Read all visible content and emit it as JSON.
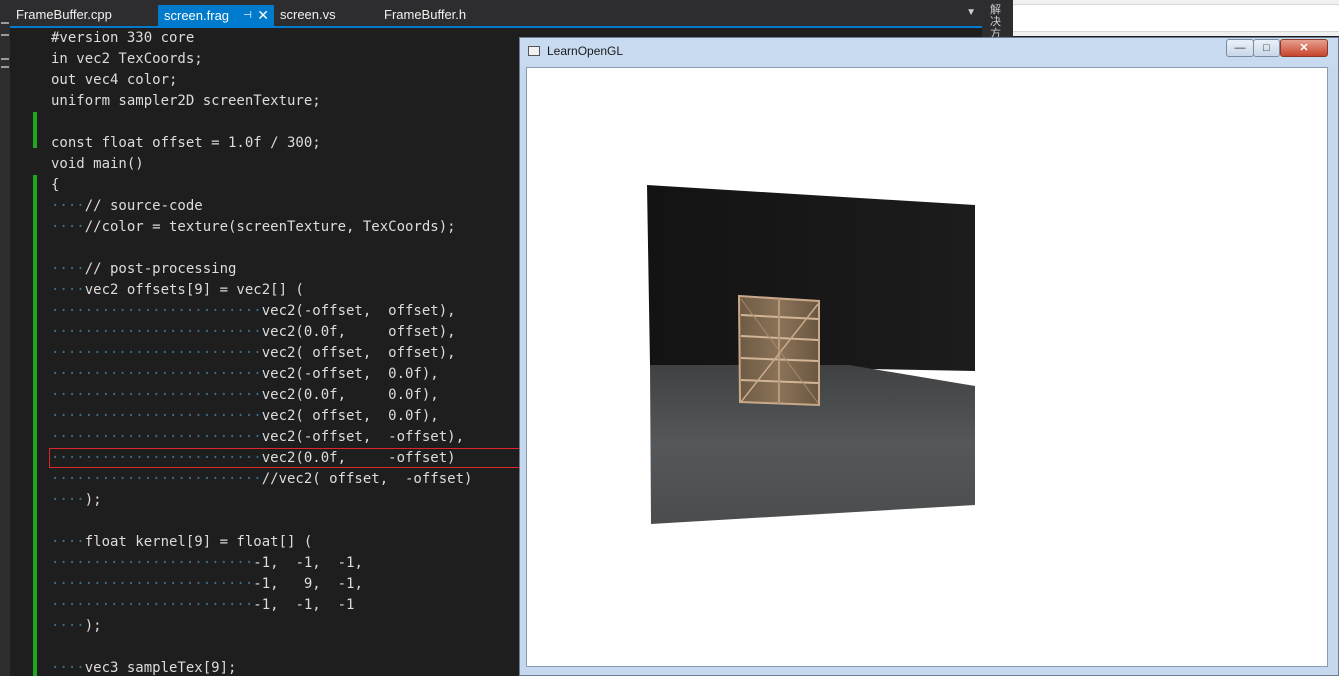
{
  "tabs": [
    {
      "label": "FrameBuffer.cpp",
      "active": false
    },
    {
      "label": "screen.frag",
      "active": true,
      "pin_icon": "pin-icon",
      "close_icon": "close-icon"
    },
    {
      "label": "screen.vs",
      "active": false
    },
    {
      "label": "FrameBuffer.h",
      "active": false
    }
  ],
  "side_panel_title": "解决方",
  "editor": {
    "lines": [
      "#version 330 core",
      "in vec2 TexCoords;",
      "out vec4 color;",
      "uniform sampler2D screenTexture;",
      "",
      "const float offset = 1.0f / 300;",
      "void main()",
      "{",
      "    // source-code",
      "    //color = texture(screenTexture, TexCoords);",
      "",
      "    // post-processing",
      "    vec2 offsets[9] = vec2[] (",
      "                         vec2(-offset,  offset),",
      "                         vec2(0.0f,     offset),",
      "                         vec2( offset,  offset),",
      "                         vec2(-offset,  0.0f),",
      "                         vec2(0.0f,     0.0f),",
      "                         vec2( offset,  0.0f),",
      "                         vec2(-offset,  -offset),",
      "                         vec2(0.0f,     -offset)",
      "                         //vec2( offset,  -offset)",
      "    );",
      "",
      "    float kernel[9] = float[] (",
      "                        -1,  -1,  -1,",
      "                        -1,   9,  -1,",
      "                        -1,  -1,  -1",
      "    );",
      "",
      "    vec3 sampleTex[9];"
    ],
    "highlighted_line": 20,
    "change_color": "#1fa81f",
    "highlight_color": "#e0252b"
  },
  "app_window": {
    "title": "LearnOpenGL",
    "minimize_label": "—",
    "maximize_label": "□",
    "close_label": "✕"
  },
  "colors": {
    "accent": "#007acc",
    "editor_bg": "#1e1e1e"
  }
}
